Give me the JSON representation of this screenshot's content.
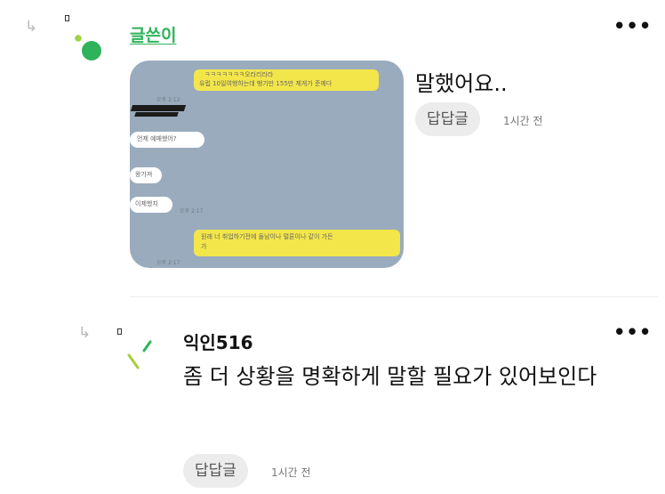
{
  "comment1": {
    "author": "글쓴이",
    "text": "말했어요..",
    "reply_label": "답답글",
    "time": "1시간 전",
    "more": "•••",
    "image": {
      "messages": [
        {
          "from": "me",
          "lines": [
            "ㅋㅋㅋㅋㅋㅋㅋ오라리라라",
            "유럽 10일여행하는데 뱅기만 155만 제게가 준께다"
          ]
        },
        {
          "from": "other",
          "lines": [
            "언제 예매했어?"
          ]
        },
        {
          "from": "other",
          "lines": [
            "왕가져"
          ]
        },
        {
          "from": "other",
          "lines": [
            "이제했지"
          ]
        },
        {
          "from": "me",
          "lines": [
            "원래 너 취업하기전에 돌남이나 멀론이나 같이 가든",
            "가"
          ]
        }
      ]
    }
  },
  "comment2": {
    "author": "익인516",
    "text": "좀 더 상황을 명확하게 말할 필요가 있어보인다",
    "reply_label": "답답글",
    "time": "1시간 전",
    "more": "•••"
  }
}
